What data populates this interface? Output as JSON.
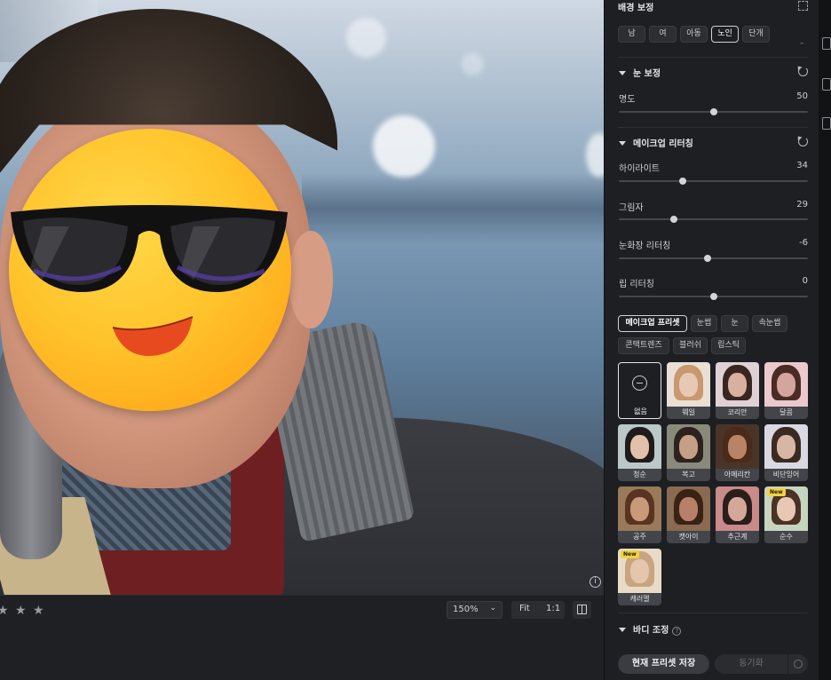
{
  "canvas": {
    "info_icon": "info-icon"
  },
  "bottombar": {
    "rating_stars": 3,
    "zoom_value": "150%",
    "fit_label": "Fit",
    "one_to_one_label": "1:1",
    "compare_icon": "split-view-icon"
  },
  "panel": {
    "background_section": {
      "title": "배경 보정",
      "age_chips": [
        "남",
        "여",
        "아동",
        "노인",
        "단개"
      ],
      "active_chip": "노인",
      "dash": "–"
    },
    "eye_section": {
      "title": "눈 보정",
      "sliders": [
        {
          "label": "명도",
          "value": "50",
          "position": 0.5
        }
      ]
    },
    "makeup_section": {
      "title": "메이크업 리터칭",
      "sliders": [
        {
          "label": "하이라이트",
          "value": "34",
          "position": 0.34
        },
        {
          "label": "그림자",
          "value": "29",
          "position": 0.29
        },
        {
          "label": "눈화장 리터칭",
          "value": "-6",
          "position": 0.47
        },
        {
          "label": "립 리터칭",
          "value": "0",
          "position": 0.5
        }
      ],
      "tabs": [
        "메이크업 프리셋",
        "눈썹",
        "눈",
        "속눈썹",
        "콘택트렌즈",
        "블러쉬",
        "립스틱"
      ],
      "active_tab": "메이크업 프리셋",
      "presets": [
        {
          "label": "없음",
          "type": "none"
        },
        {
          "label": "웨일",
          "new": false
        },
        {
          "label": "코리안",
          "new": false
        },
        {
          "label": "달콤",
          "new": false
        },
        {
          "label": "청순",
          "new": false
        },
        {
          "label": "복고",
          "new": false
        },
        {
          "label": "아메리칸",
          "new": false
        },
        {
          "label": "비단잉어",
          "new": false
        },
        {
          "label": "공주",
          "new": false
        },
        {
          "label": "캣아이",
          "new": false
        },
        {
          "label": "추근계",
          "new": false
        },
        {
          "label": "순수",
          "new": true
        },
        {
          "label": "캐러멜",
          "new": true
        }
      ],
      "new_badge": "New"
    },
    "body_section": {
      "title": "바디 조정"
    },
    "footer": {
      "save_label": "현재 프리셋 저장",
      "sync_label": "동기화"
    }
  }
}
